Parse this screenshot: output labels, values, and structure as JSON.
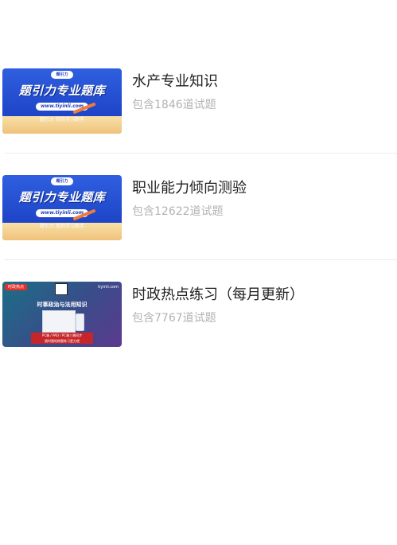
{
  "items": [
    {
      "title": "水产专业知识",
      "count": "包含1846道试题",
      "thumb": {
        "headline": "题引力专业题库",
        "url": "www.tiyinli.com",
        "badge": "题引力",
        "slogan": "题引力 你的学习助手"
      }
    },
    {
      "title": "职业能力倾向测验",
      "count": "包含12622道试题",
      "thumb": {
        "headline": "题引力专业题库",
        "url": "www.tiyinli.com",
        "badge": "题引力",
        "slogan": "题引力 你的学习助手"
      }
    },
    {
      "title": "时政热点练习（每月更新）",
      "count": "包含7767道试题",
      "thumb": {
        "tag": "时政热点",
        "domain": "tiyinli.com",
        "headline": "时事政治与法用知识",
        "box_line1": "PC端 / PAD / PC端三端同步",
        "box_line2": "随时随地刷题练习更方便"
      }
    }
  ],
  "colors": {
    "title": "#222222",
    "count": "#b3b3b3",
    "divider": "#ececec",
    "banner_blue": "#1f45c8"
  }
}
